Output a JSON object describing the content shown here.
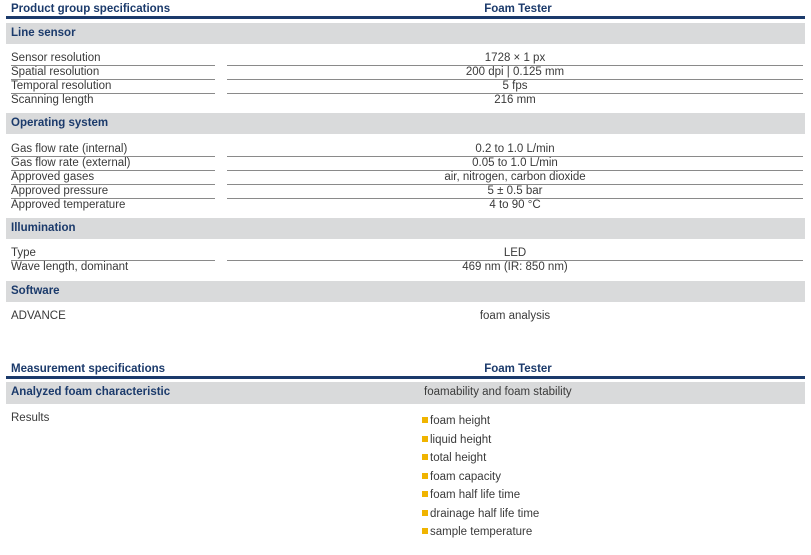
{
  "table1": {
    "header_left": "Product group specifications",
    "header_right": "Foam Tester",
    "line_sensor": {
      "title": "Line sensor",
      "rows": [
        {
          "label": "Sensor resolution",
          "value": "1728 × 1 px"
        },
        {
          "label": "Spatial resolution",
          "value": "200 dpi | 0.125 mm"
        },
        {
          "label": "Temporal resolution",
          "value": "5 fps"
        },
        {
          "label": "Scanning length",
          "value": "216 mm"
        }
      ]
    },
    "operating_system": {
      "title": "Operating system",
      "rows": [
        {
          "label": "Gas flow rate (internal)",
          "value": "0.2 to 1.0 L/min"
        },
        {
          "label": "Gas flow rate (external)",
          "value": "0.05 to 1.0 L/min"
        },
        {
          "label": "Approved gases",
          "value": "air, nitrogen, carbon dioxide"
        },
        {
          "label": "Approved pressure",
          "value": "5 ± 0.5 bar"
        },
        {
          "label": "Approved temperature",
          "value": "4 to 90 °C"
        }
      ]
    },
    "illumination": {
      "title": "Illumination",
      "rows": [
        {
          "label": "Type",
          "value": "LED"
        },
        {
          "label": "Wave length, dominant",
          "value": "469 nm (IR: 850 nm)"
        }
      ]
    },
    "software": {
      "title": "Software",
      "rows": [
        {
          "label": "ADVANCE",
          "value": "foam analysis"
        }
      ]
    }
  },
  "table2": {
    "header_left": "Measurement specifications",
    "header_right": "Foam Tester",
    "analyzed": {
      "label": "Analyzed foam characteristic",
      "value": "foamability and foam stability"
    },
    "results": {
      "label": "Results",
      "items": [
        "foam height",
        "liquid height",
        "total height",
        "foam capacity",
        "foam half life time",
        "drainage half life time",
        "sample temperature"
      ]
    }
  },
  "colors": {
    "heading_blue": "#1b3a6b",
    "section_gray": "#d9dadb",
    "bullet_yellow": "#f0b400"
  }
}
